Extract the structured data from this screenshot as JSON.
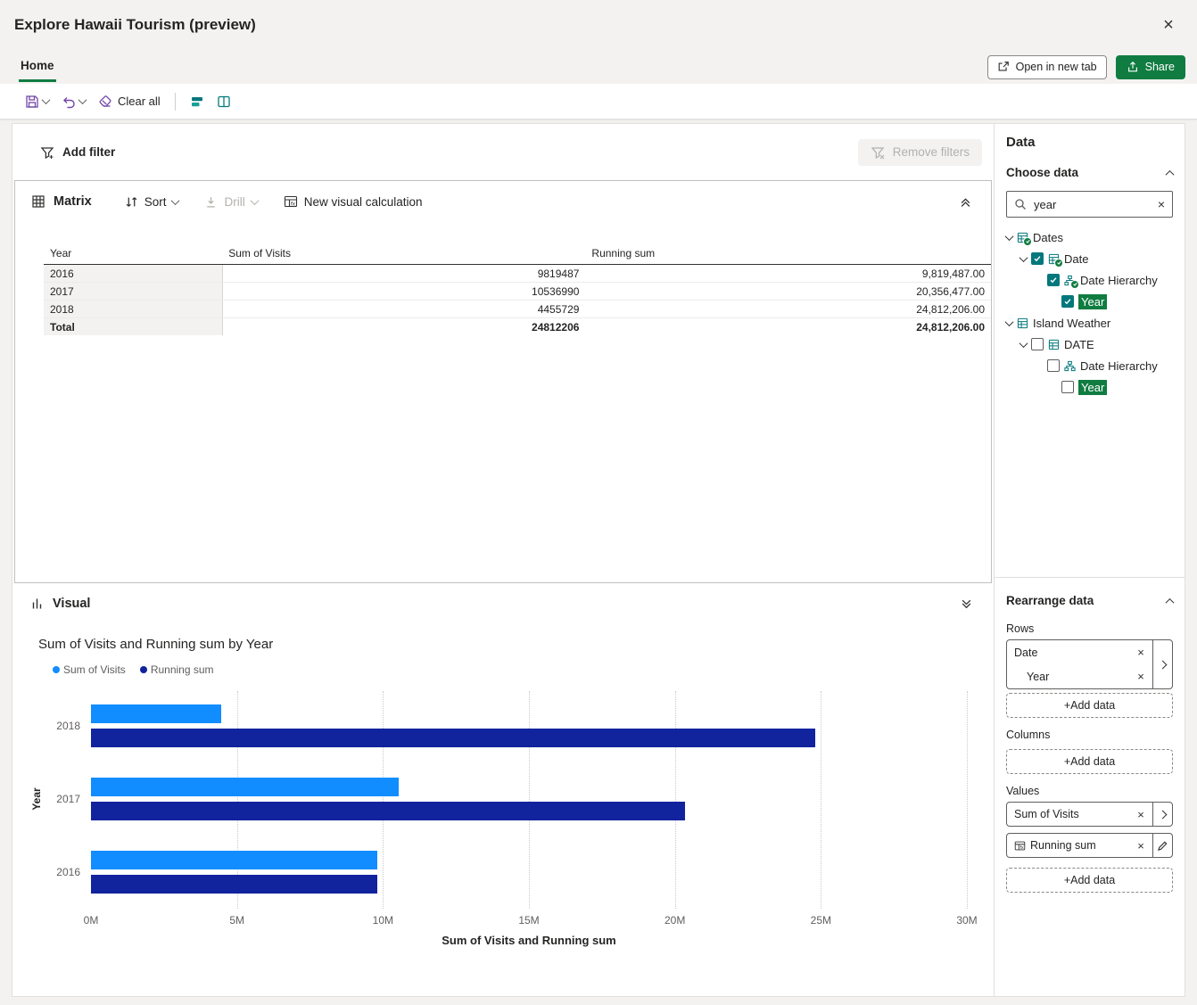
{
  "window": {
    "title": "Explore Hawaii Tourism (preview)",
    "close_icon": "×"
  },
  "tabs": {
    "home": "Home",
    "open_in_new_tab": "Open in new tab",
    "share": "Share"
  },
  "toolbar": {
    "clear_all": "Clear all"
  },
  "filter_bar": {
    "add_filter": "Add filter",
    "remove_filters": "Remove filters"
  },
  "matrix": {
    "title": "Matrix",
    "sort_label": "Sort",
    "drill_label": "Drill",
    "new_visual_calculation_label": "New visual calculation",
    "columns": [
      "Year",
      "Sum of Visits",
      "Running sum"
    ],
    "rows": [
      [
        "2016",
        "9819487",
        "9,819,487.00"
      ],
      [
        "2017",
        "10536990",
        "20,356,477.00"
      ],
      [
        "2018",
        "4455729",
        "24,812,206.00"
      ],
      [
        "Total",
        "24812206",
        "24,812,206.00"
      ]
    ]
  },
  "visual": {
    "title": "Visual"
  },
  "chart_data": {
    "type": "bar",
    "orientation": "horizontal",
    "title": "Sum of Visits and Running sum by Year",
    "categories": [
      "2018",
      "2017",
      "2016"
    ],
    "series": [
      {
        "name": "Sum of Visits",
        "color": "#118DFF",
        "values": [
          4455729,
          10536990,
          9819487
        ]
      },
      {
        "name": "Running sum",
        "color": "#12239E",
        "values": [
          24812206,
          20356477,
          9819487
        ]
      }
    ],
    "xlabel": "Sum of Visits and Running sum",
    "ylabel": "Year",
    "xlim": [
      0,
      30000000
    ],
    "x_ticks": [
      "0M",
      "5M",
      "10M",
      "15M",
      "20M",
      "25M",
      "30M"
    ],
    "x_tick_values": [
      0,
      5000000,
      10000000,
      15000000,
      20000000,
      25000000,
      30000000
    ],
    "grid": "dotted-vertical",
    "legend_position": "top-left"
  },
  "data_panel": {
    "title": "Data",
    "choose_data_label": "Choose data",
    "search": {
      "value": "year"
    },
    "tree": [
      {
        "label": "Dates",
        "level": 0,
        "chevron": true,
        "checkbox": "none",
        "icon": "table",
        "badge": true,
        "highlight": false
      },
      {
        "label": "Date",
        "level": 1,
        "chevron": true,
        "checkbox": "checked",
        "icon": "table",
        "badge": true,
        "highlight": false
      },
      {
        "label": "Date Hierarchy",
        "level": 2,
        "chevron": false,
        "checkbox": "checked",
        "icon": "hierarchy",
        "badge": true,
        "highlight": false
      },
      {
        "label": "Year",
        "level": 3,
        "chevron": false,
        "checkbox": "checked",
        "icon": "none",
        "badge": false,
        "highlight": true
      },
      {
        "label": "Island Weather",
        "level": 0,
        "chevron": true,
        "checkbox": "none",
        "icon": "table",
        "badge": false,
        "highlight": false
      },
      {
        "label": "DATE",
        "level": 1,
        "chevron": true,
        "checkbox": "unchecked",
        "icon": "table",
        "badge": false,
        "highlight": false
      },
      {
        "label": "Date Hierarchy",
        "level": 2,
        "chevron": false,
        "checkbox": "unchecked",
        "icon": "hierarchy",
        "badge": false,
        "highlight": false
      },
      {
        "label": "Year",
        "level": 3,
        "chevron": false,
        "checkbox": "unchecked",
        "icon": "none",
        "badge": false,
        "highlight": true
      }
    ],
    "rearrange": {
      "title": "Rearrange data",
      "rows_label": "Rows",
      "rows": [
        {
          "label": "Date"
        },
        {
          "label": "Year"
        }
      ],
      "columns_label": "Columns",
      "values_label": "Values",
      "values": [
        {
          "label": "Sum of Visits",
          "fx": false
        },
        {
          "label": "Running sum",
          "fx": true
        }
      ],
      "add_data_label": "+Add data"
    }
  },
  "colors": {
    "accent_green": "#107C41",
    "checkbox_teal": "#03787C",
    "toolbar_purple": "#7245A8",
    "series_1": "#118DFF",
    "series_2": "#12239E"
  }
}
